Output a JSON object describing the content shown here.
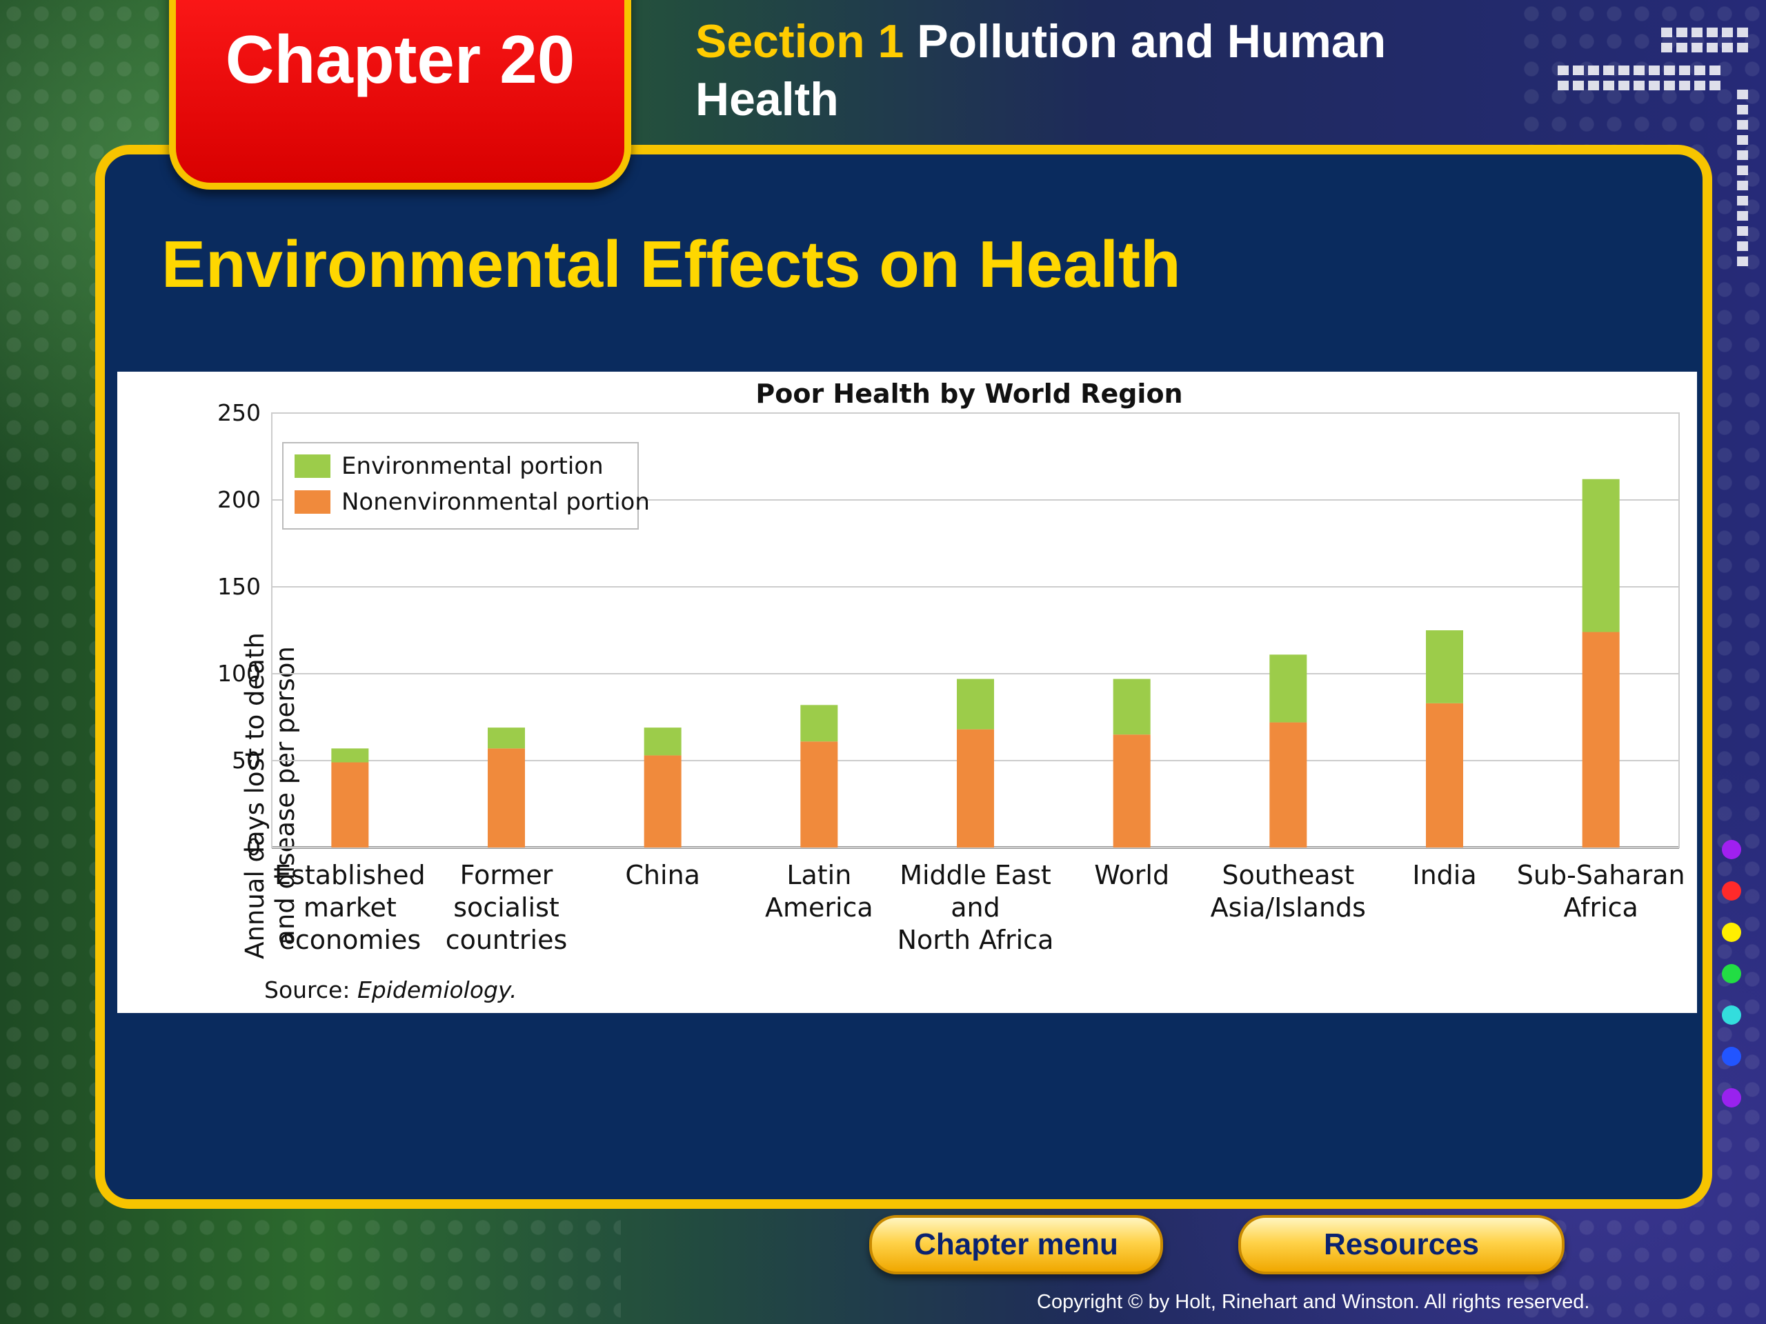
{
  "header": {
    "chapter_label": "Chapter 20",
    "section_label": "Section 1",
    "section_title": "Pollution and Human Health"
  },
  "slide_title": "Environmental Effects on Health",
  "nav": {
    "chapter_menu_label": "Chapter menu",
    "resources_label": "Resources"
  },
  "footer": {
    "copyright": "Copyright © by Holt, Rinehart and Winston. All rights reserved."
  },
  "side_dot_colors": [
    "#a020f0",
    "#ff2a2a",
    "#ffee00",
    "#22dd44",
    "#33dddd",
    "#2255ff",
    "#9922ee"
  ],
  "chart_data": {
    "type": "bar",
    "stacked": true,
    "title": "Poor Health by World Region",
    "ylabel": [
      "Annual days lost to death",
      "and disease per person"
    ],
    "xlabel": "",
    "ylim": [
      0,
      250
    ],
    "yticks": [
      0,
      50,
      100,
      150,
      200,
      250
    ],
    "grid": true,
    "legend_position": "top-left",
    "categories": [
      [
        "Established",
        "market",
        "economies"
      ],
      [
        "Former",
        "socialist",
        "countries"
      ],
      [
        "China"
      ],
      [
        "Latin",
        "America"
      ],
      [
        "Middle East",
        "and",
        "North Africa"
      ],
      [
        "World"
      ],
      [
        "Southeast",
        "Asia/Islands"
      ],
      [
        "India"
      ],
      [
        "Sub-Saharan",
        "Africa"
      ]
    ],
    "series": [
      {
        "name": "Nonenvironmental portion",
        "color": "#f08a3c",
        "values": [
          49,
          57,
          53,
          61,
          68,
          65,
          72,
          83,
          124
        ]
      },
      {
        "name": "Environmental portion",
        "color": "#9ccc4a",
        "values": [
          8,
          12,
          16,
          21,
          29,
          32,
          39,
          42,
          88
        ]
      }
    ],
    "source_prefix": "Source: ",
    "source_name": "Epidemiology."
  }
}
